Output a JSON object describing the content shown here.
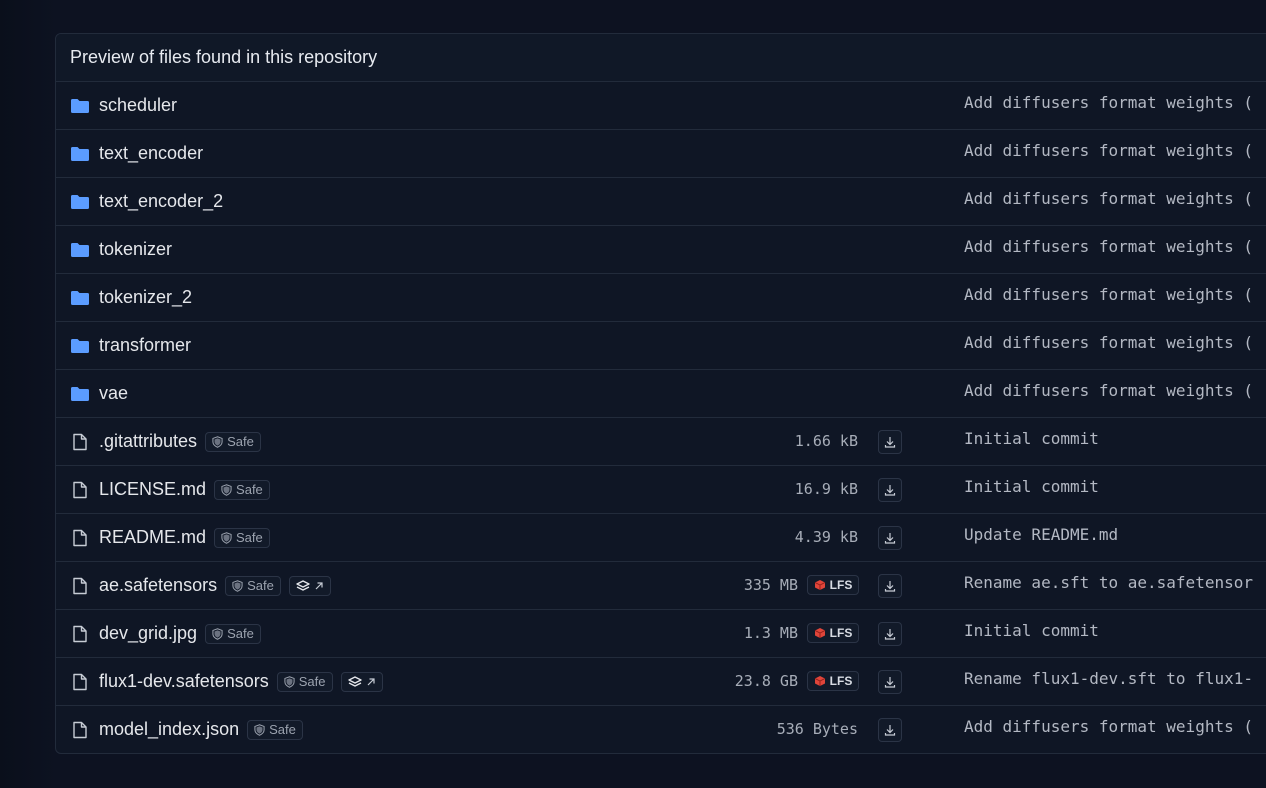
{
  "header": {
    "title": "Preview of files found in this repository"
  },
  "colors": {
    "folder": "#5b9cff",
    "lfs_cube": "#e0453a",
    "background": "#0d1221"
  },
  "rows": [
    {
      "type": "folder",
      "icon": "folder-icon",
      "name": "scheduler",
      "commit": "Add diffusers format weights ("
    },
    {
      "type": "folder",
      "icon": "folder-icon",
      "name": "text_encoder",
      "commit": "Add diffusers format weights ("
    },
    {
      "type": "folder",
      "icon": "folder-icon",
      "name": "text_encoder_2",
      "commit": "Add diffusers format weights ("
    },
    {
      "type": "folder",
      "icon": "folder-icon",
      "name": "tokenizer",
      "commit": "Add diffusers format weights ("
    },
    {
      "type": "folder",
      "icon": "folder-icon",
      "name": "tokenizer_2",
      "commit": "Add diffusers format weights ("
    },
    {
      "type": "folder",
      "icon": "folder-icon",
      "name": "transformer",
      "commit": "Add diffusers format weights ("
    },
    {
      "type": "folder",
      "icon": "folder-icon",
      "name": "vae",
      "commit": "Add diffusers format weights ("
    },
    {
      "type": "file",
      "icon": "file-icon",
      "name": ".gitattributes",
      "badge": "Safe",
      "size": "1.66 kB",
      "commit": "Initial commit"
    },
    {
      "type": "file",
      "icon": "file-icon",
      "name": "LICENSE.md",
      "badge": "Safe",
      "size": "16.9 kB",
      "commit": "Initial commit"
    },
    {
      "type": "file",
      "icon": "file-icon",
      "name": "README.md",
      "badge": "Safe",
      "size": "4.39 kB",
      "commit": "Update README.md"
    },
    {
      "type": "file",
      "icon": "file-icon",
      "name": "ae.safetensors",
      "badge": "Safe",
      "xet": true,
      "size": "335 MB",
      "lfs": "LFS",
      "commit": "Rename ae.sft to ae.safetensor"
    },
    {
      "type": "file",
      "icon": "file-icon",
      "name": "dev_grid.jpg",
      "badge": "Safe",
      "size": "1.3 MB",
      "lfs": "LFS",
      "commit": "Initial commit"
    },
    {
      "type": "file",
      "icon": "file-icon",
      "name": "flux1-dev.safetensors",
      "badge": "Safe",
      "xet": true,
      "size": "23.8 GB",
      "lfs": "LFS",
      "commit": "Rename flux1-dev.sft to flux1-"
    },
    {
      "type": "file",
      "icon": "file-icon",
      "name": "model_index.json",
      "badge": "Safe",
      "size": "536 Bytes",
      "commit": "Add diffusers format weights ("
    }
  ]
}
